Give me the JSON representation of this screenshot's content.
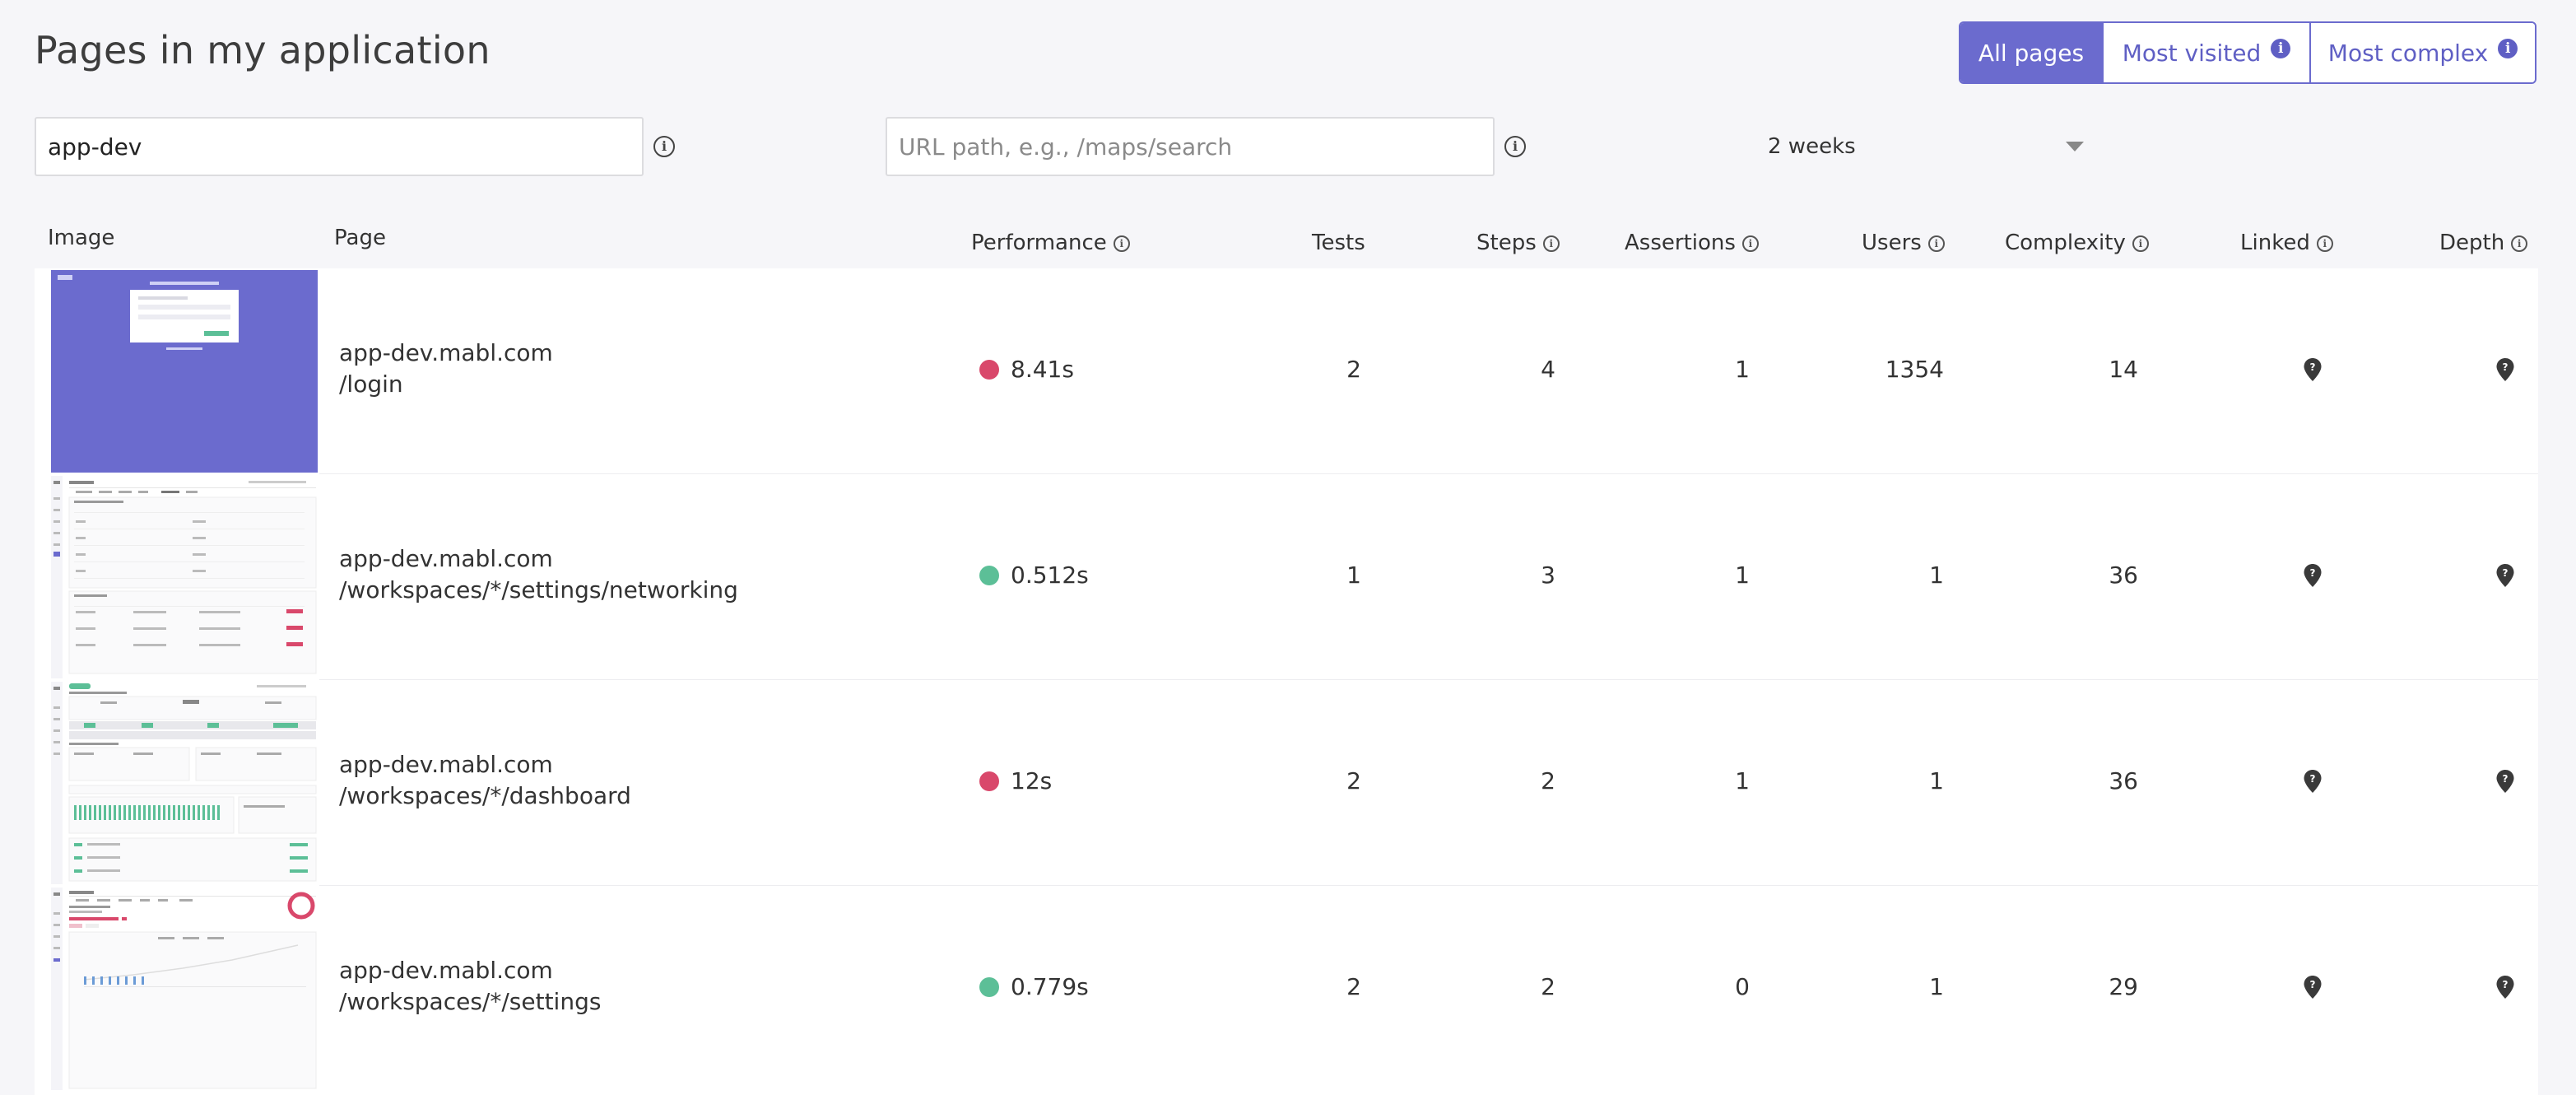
{
  "header": {
    "title": "Pages in my application",
    "view_toggle": [
      {
        "label": "All pages",
        "active": true
      },
      {
        "label": "Most visited",
        "active": false
      },
      {
        "label": "Most complex",
        "active": false
      }
    ]
  },
  "filters": {
    "search_value": "app-dev",
    "url_placeholder": "URL path, e.g., /maps/search",
    "period": "2 weeks"
  },
  "columns": {
    "image": "Image",
    "page": "Page",
    "performance": "Performance",
    "tests": "Tests",
    "steps": "Steps",
    "assertions": "Assertions",
    "users": "Users",
    "complexity": "Complexity",
    "linked": "Linked",
    "depth": "Depth"
  },
  "rows": [
    {
      "host": "app-dev.mabl.com",
      "path": "/login",
      "performance": "8.41s",
      "perf_status": "slow",
      "tests": "2",
      "steps": "4",
      "assertions": "1",
      "users": "1354",
      "complexity": "14",
      "thumbnail": "login-screenshot"
    },
    {
      "host": "app-dev.mabl.com",
      "path": "/workspaces/*/settings/networking",
      "performance": "0.512s",
      "perf_status": "fast",
      "tests": "1",
      "steps": "3",
      "assertions": "1",
      "users": "1",
      "complexity": "36",
      "thumbnail": "networking-screenshot"
    },
    {
      "host": "app-dev.mabl.com",
      "path": "/workspaces/*/dashboard",
      "performance": "12s",
      "perf_status": "slow",
      "tests": "2",
      "steps": "2",
      "assertions": "1",
      "users": "1",
      "complexity": "36",
      "thumbnail": "dashboard-screenshot"
    },
    {
      "host": "app-dev.mabl.com",
      "path": "/workspaces/*/settings",
      "performance": "0.779s",
      "perf_status": "fast",
      "tests": "2",
      "steps": "2",
      "assertions": "0",
      "users": "1",
      "complexity": "29",
      "thumbnail": "settings-screenshot"
    }
  ],
  "colors": {
    "accent": "#6b6bce",
    "perf_slow": "#d9486b",
    "perf_fast": "#5cbf97"
  },
  "icons": {
    "info": "info-icon",
    "linked": "map-pin-icon",
    "depth": "map-pin-icon",
    "dropdown": "chevron-down-icon"
  }
}
